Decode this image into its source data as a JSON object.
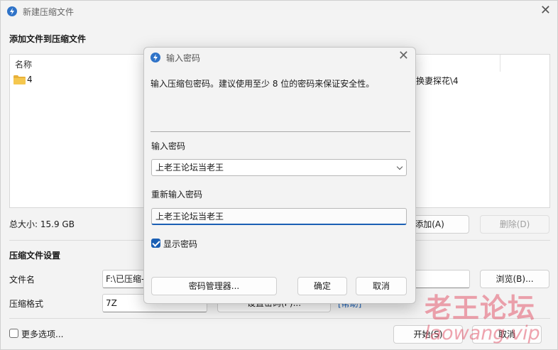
{
  "window": {
    "title": "新建压缩文件",
    "section_add": "添加文件到压缩文件",
    "list": {
      "column_name": "名称",
      "item_name": "4",
      "item_path": "换妻探花\\4"
    },
    "total_size": "总大小: 15.9 GB",
    "add_button": "添加(A)",
    "delete_button": "删除(D)",
    "settings_header": "压缩文件设置",
    "filename_label": "文件名",
    "filename_value": "F:\\已压缩-",
    "browse_button": "浏览(B)...",
    "format_label": "压缩格式",
    "format_value": "7Z",
    "partial_button": "设置密码(P)...",
    "partial_link": "[帮助]",
    "more_options": "更多选项...",
    "start_button": "开始(S)",
    "cancel_button": "取消"
  },
  "dialog": {
    "title": "输入密码",
    "description": "输入压缩包密码。建议使用至少 8 位的密码来保证安全性。",
    "password_label": "输入密码",
    "password_value": "上老王论坛当老王",
    "repeat_label": "重新输入密码",
    "repeat_value": "上老王论坛当老王",
    "show_password": "显示密码",
    "show_password_checked": true,
    "manager_button": "密码管理器...",
    "ok_button": "确定",
    "cancel_button": "取消"
  },
  "watermark": {
    "line1": "老王论坛",
    "line2": "laowang.vip"
  },
  "colors": {
    "accent": "#1a5fb4",
    "app_icon": "#2f73c8",
    "watermark": "#e25a6e"
  }
}
